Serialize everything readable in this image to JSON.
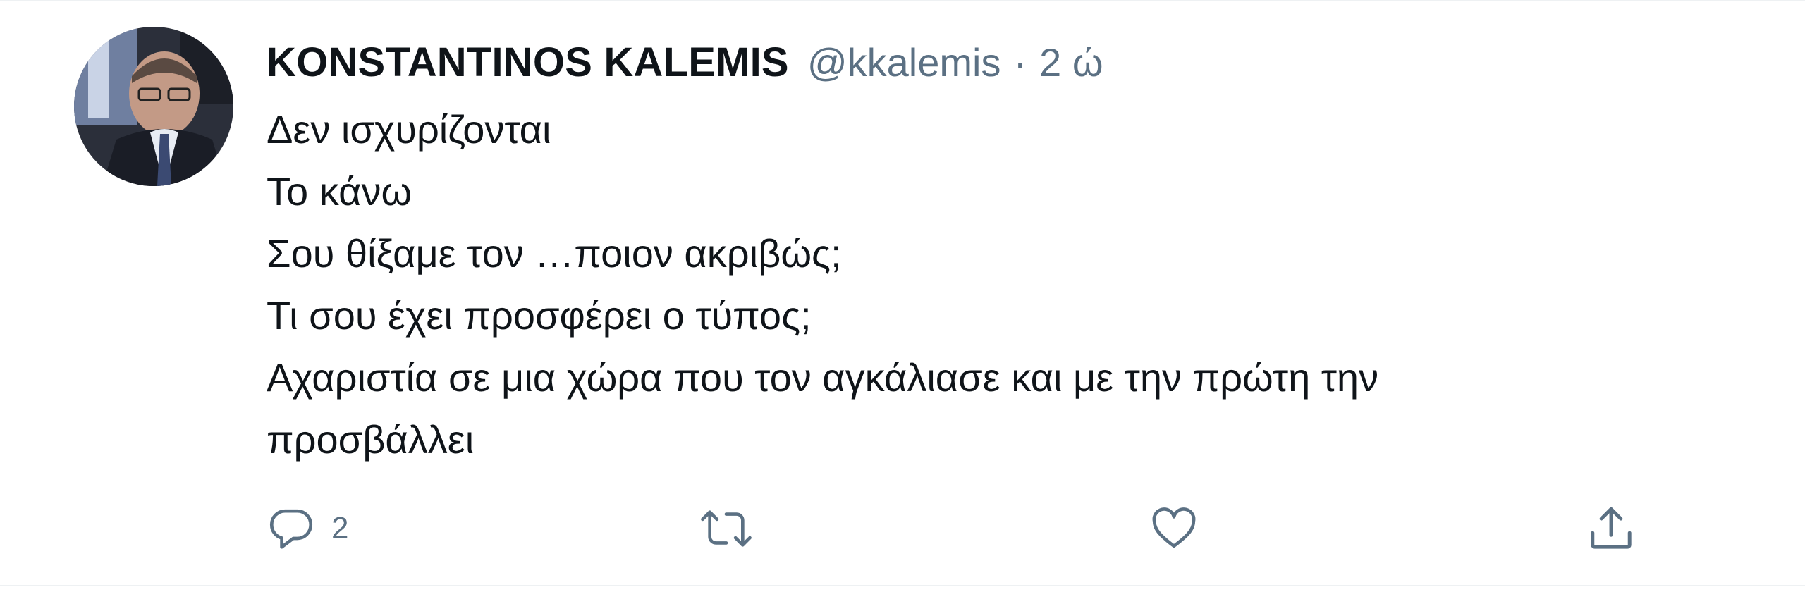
{
  "tweet": {
    "author_name": "KONSTANTINOS KALEMIS",
    "handle": "@kkalemis",
    "separator": "·",
    "time": "2 ώ",
    "lines": [
      "Δεν ισχυρίζονται",
      "Το κάνω",
      "Σου θίξαμε τον …ποιον ακριβώς;",
      "Τι σου έχει προσφέρει ο τύπος;",
      "Αχαριστία σε μια χώρα που τον αγκάλιασε και με την πρώτη την",
      "προσβάλλει"
    ]
  },
  "actions": {
    "reply": {
      "icon": "reply-icon",
      "count": "2"
    },
    "retweet": {
      "icon": "retweet-icon"
    },
    "like": {
      "icon": "heart-icon"
    },
    "share": {
      "icon": "share-icon"
    }
  },
  "colors": {
    "text_primary": "#0f1419",
    "text_secondary": "#5b7083",
    "icon": "#5b7083"
  }
}
